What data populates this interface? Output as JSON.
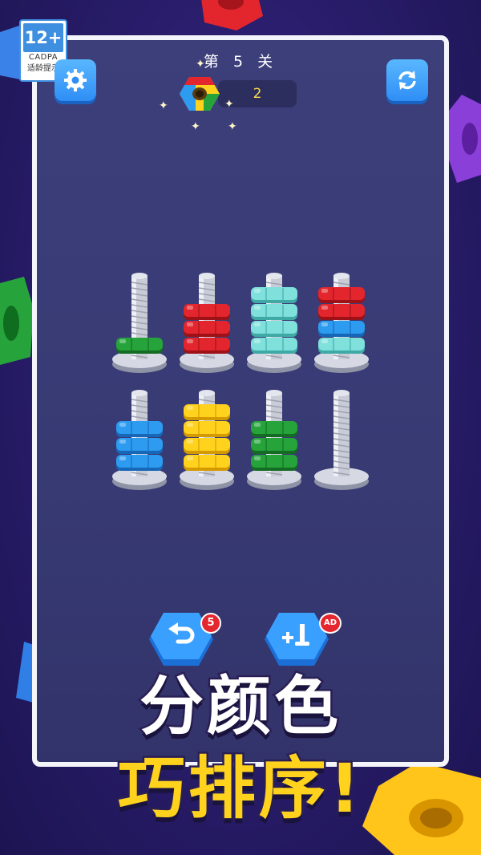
{
  "rating": {
    "age": "12+",
    "org": "CADPA",
    "note": "适龄提示"
  },
  "header": {
    "level_text": "第 5 关",
    "score": "2"
  },
  "actions": {
    "undo_count": "5",
    "ad_label": "AD"
  },
  "promo": {
    "line1": "分颜色",
    "line2": "巧排序!"
  },
  "colors": {
    "red": "#e3262d",
    "green": "#27a33b",
    "cyan": "#7fe0dc",
    "blue": "#2d9bf0",
    "yellow": "#ffd21e"
  },
  "pegs": [
    {
      "row": 1,
      "nuts": [
        "green"
      ]
    },
    {
      "row": 1,
      "nuts": [
        "red",
        "red",
        "red"
      ]
    },
    {
      "row": 1,
      "nuts": [
        "cyan",
        "cyan",
        "cyan",
        "cyan"
      ]
    },
    {
      "row": 1,
      "nuts": [
        "cyan",
        "blue",
        "red",
        "red"
      ]
    },
    {
      "row": 2,
      "nuts": [
        "blue",
        "blue",
        "blue"
      ]
    },
    {
      "row": 2,
      "nuts": [
        "yellow",
        "yellow",
        "yellow",
        "yellow"
      ]
    },
    {
      "row": 2,
      "nuts": [
        "green",
        "green",
        "green"
      ]
    },
    {
      "row": 2,
      "nuts": []
    }
  ]
}
